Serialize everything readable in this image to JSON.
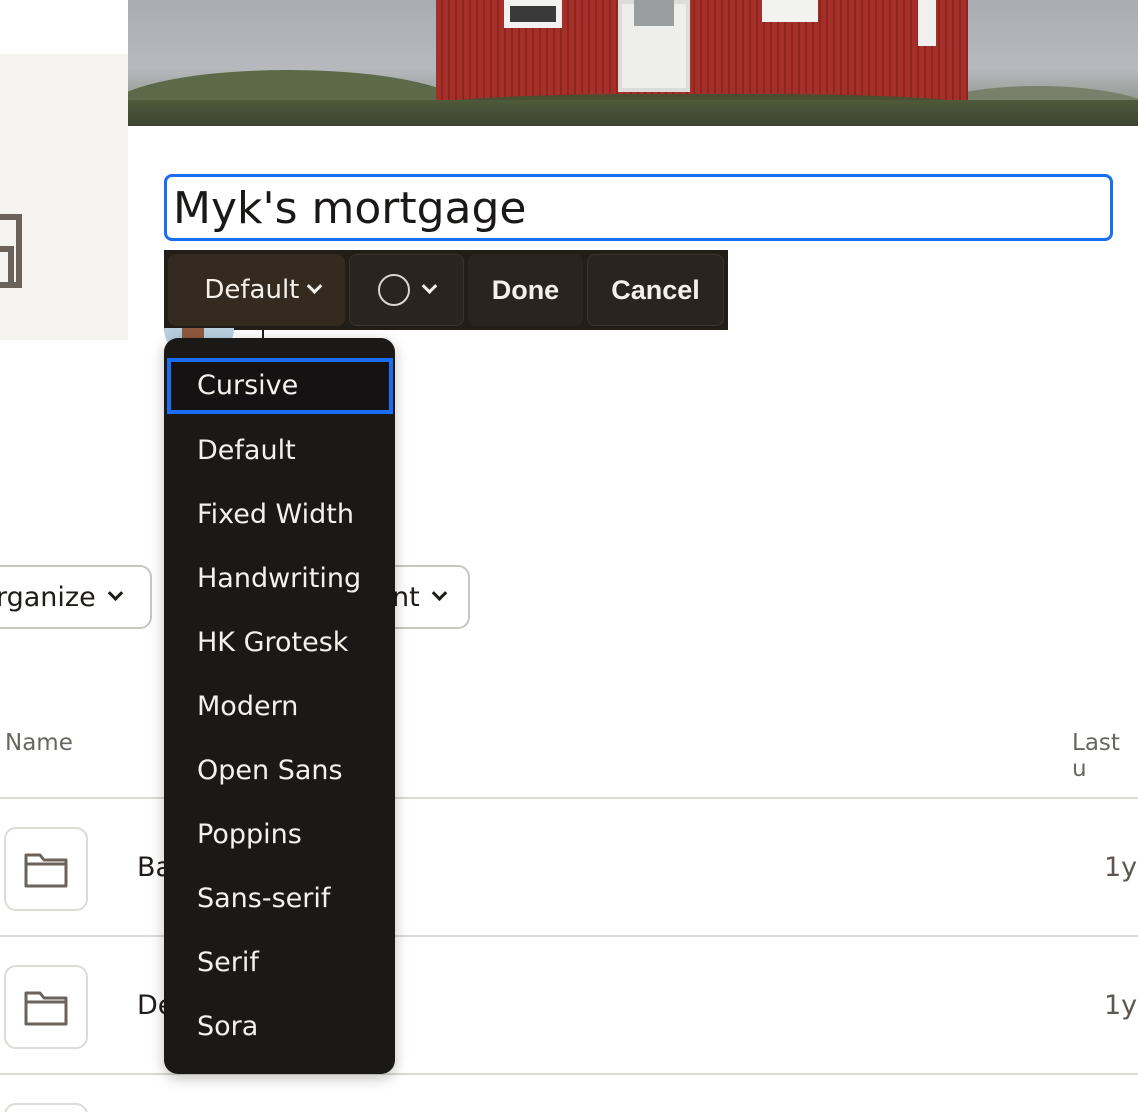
{
  "title_input": {
    "value": "Myk's mortgage"
  },
  "toolbar": {
    "font_label": "Default",
    "done_label": "Done",
    "cancel_label": "Cancel"
  },
  "font_menu": {
    "items": [
      "Cursive",
      "Default",
      "Fixed Width",
      "Handwriting",
      "HK Grotesk",
      "Modern",
      "Open Sans",
      "Poppins",
      "Sans-serif",
      "Serif",
      "Sora"
    ],
    "highlighted": "Cursive"
  },
  "filters": {
    "organize_label": "rganize",
    "second_label": "nt"
  },
  "table": {
    "headers": {
      "name": "Name",
      "last": "Last u"
    },
    "rows": [
      {
        "name": "Ba",
        "time": "1y"
      },
      {
        "name": "De",
        "time": "1y"
      }
    ]
  },
  "colors": {
    "accent": "#1b6ef3",
    "toolbar_bg": "#231d18",
    "menu_bg": "#1b1918"
  }
}
